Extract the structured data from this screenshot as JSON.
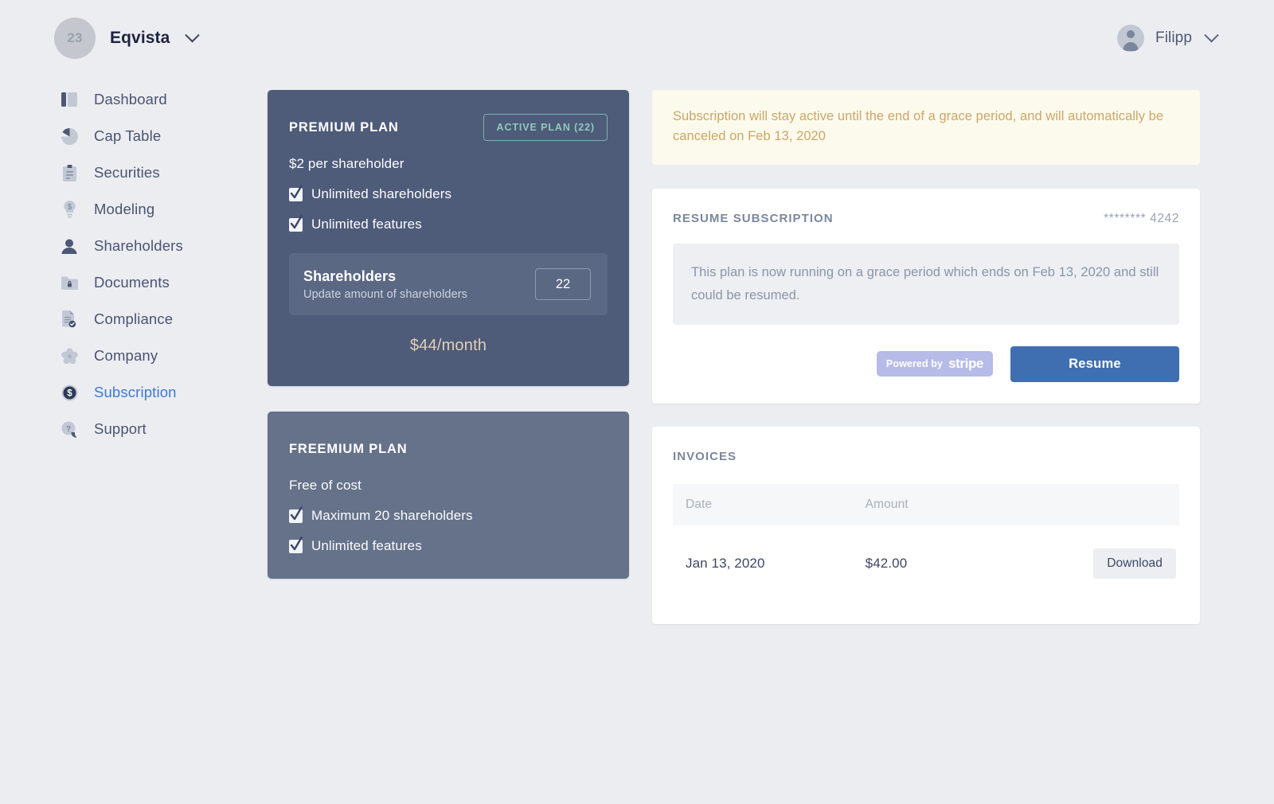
{
  "topbar": {
    "company_badge": "23",
    "company_name": "Eqvista",
    "company_chevron_icon": "chevron-down-icon",
    "user_name": "Filipp",
    "user_chevron_icon": "chevron-down-icon",
    "user_avatar_icon": "user-avatar-icon"
  },
  "sidebar": {
    "items": [
      {
        "label": "Dashboard",
        "icon": "dashboard-icon",
        "active": false
      },
      {
        "label": "Cap Table",
        "icon": "pie-chart-icon",
        "active": false
      },
      {
        "label": "Securities",
        "icon": "clipboard-icon",
        "active": false
      },
      {
        "label": "Modeling",
        "icon": "lightbulb-dollar-icon",
        "active": false
      },
      {
        "label": "Shareholders",
        "icon": "person-icon",
        "active": false
      },
      {
        "label": "Documents",
        "icon": "folder-lock-icon",
        "active": false
      },
      {
        "label": "Compliance",
        "icon": "document-check-icon",
        "active": false
      },
      {
        "label": "Company",
        "icon": "flower-icon",
        "active": false
      },
      {
        "label": "Subscription",
        "icon": "dollar-coin-icon",
        "active": true
      },
      {
        "label": "Support",
        "icon": "question-chat-icon",
        "active": false
      }
    ]
  },
  "premium_plan": {
    "title": "PREMIUM PLAN",
    "badge_label": "ACTIVE PLAN (22)",
    "price_per": "$2 per shareholder",
    "features": [
      "Unlimited shareholders",
      "Unlimited features"
    ],
    "shareholders_title": "Shareholders",
    "shareholders_desc": "Update amount of shareholders",
    "shareholders_value": "22",
    "total_price": "$44/month"
  },
  "freemium_plan": {
    "title": "FREEMIUM PLAN",
    "price_per": "Free of cost",
    "features": [
      "Maximum 20 shareholders",
      "Unlimited features"
    ]
  },
  "notice": {
    "text": "Subscription will stay active until the end of a grace period, and will automatically be canceled on Feb 13, 2020"
  },
  "resume_card": {
    "title": "RESUME SUBSCRIPTION",
    "card_mask": "******** 4242",
    "info_text": "This plan is now running on a grace period which ends on Feb 13, 2020 and still could be resumed.",
    "stripe_prefix": "Powered by",
    "stripe_word": "stripe",
    "resume_label": "Resume"
  },
  "invoices": {
    "title": "INVOICES",
    "columns": [
      "Date",
      "Amount",
      ""
    ],
    "rows": [
      {
        "date": "Jan 13, 2020",
        "amount": "$42.00",
        "action": "Download"
      }
    ]
  },
  "colors": {
    "page_bg": "#ecedf1",
    "premium_bg": "#4e5b79",
    "freemium_bg": "#65728a",
    "accent_blue": "#3b7ad4",
    "resume_blue": "#3f6fb0",
    "badge_teal": "#8fc9bf",
    "notice_bg": "#fcfaed",
    "notice_text": "#cba765",
    "price_tan": "#e3cfb6"
  }
}
